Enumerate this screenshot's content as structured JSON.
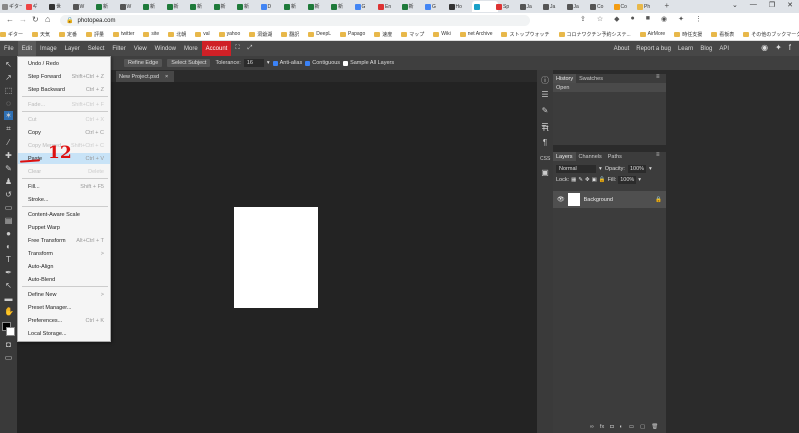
{
  "browser": {
    "tabs": [
      {
        "label": "ギター",
        "color": "#888"
      },
      {
        "label": "ギ",
        "color": "#e44"
      },
      {
        "label": "世",
        "color": "#333"
      },
      {
        "label": "W",
        "color": "#555"
      },
      {
        "label": "新",
        "color": "#1e7a3a"
      },
      {
        "label": "W",
        "color": "#555"
      },
      {
        "label": "新",
        "color": "#1e7a3a"
      },
      {
        "label": "新",
        "color": "#1e7a3a"
      },
      {
        "label": "新",
        "color": "#1e7a3a"
      },
      {
        "label": "新",
        "color": "#1e7a3a"
      },
      {
        "label": "新",
        "color": "#1e7a3a"
      },
      {
        "label": "D",
        "color": "#4285f4"
      },
      {
        "label": "新",
        "color": "#1e7a3a"
      },
      {
        "label": "新",
        "color": "#1e7a3a"
      },
      {
        "label": "新",
        "color": "#1e7a3a"
      },
      {
        "label": "G",
        "color": "#4285f4"
      },
      {
        "label": "En",
        "color": "#d33"
      },
      {
        "label": "新",
        "color": "#1e7a3a"
      },
      {
        "label": "G",
        "color": "#4285f4"
      },
      {
        "label": "Ho",
        "color": "#333"
      },
      {
        "label": "",
        "color": "#18a0c8"
      },
      {
        "label": "Sp",
        "color": "#d33"
      },
      {
        "label": "Ja",
        "color": "#555"
      },
      {
        "label": "Ja",
        "color": "#555"
      },
      {
        "label": "Ja",
        "color": "#555"
      },
      {
        "label": "Co",
        "color": "#555"
      },
      {
        "label": "Co",
        "color": "#f39c12"
      },
      {
        "label": "Ph",
        "color": "#e8b84a"
      }
    ],
    "url": "photopea.com",
    "bookmarks": [
      "ギター",
      "天気",
      "定番",
      "評量",
      "twitter",
      "site",
      "北朝",
      "val",
      "yahoo",
      "洞爺湖",
      "翻訳",
      "DeepL",
      "Papago",
      "速度",
      "マップ",
      "Wiki",
      "net Archive",
      "ストップウォッチ",
      "コロナワクチン予約システ...",
      "AirMore",
      "時任支援",
      "看板表",
      "その他のブックマーク"
    ]
  },
  "menubar": {
    "items": [
      "File",
      "Edit",
      "Image",
      "Layer",
      "Select",
      "Filter",
      "View",
      "Window",
      "More",
      "Account"
    ],
    "right": [
      "About",
      "Report a bug",
      "Learn",
      "Blog",
      "API"
    ]
  },
  "options": {
    "refine_edge": "Refine Edge",
    "select_subject": "Select Subject",
    "tolerance_label": "Tolerance:",
    "tolerance_value": "16",
    "anti_alias": "Anti-alias",
    "contiguous": "Contiguous",
    "sample_all": "Sample All Layers"
  },
  "document": {
    "tab_name": "New Project.psd",
    "close": "×"
  },
  "edit_menu": [
    {
      "label": "Undo / Redo",
      "shortcut": "",
      "disabled": false,
      "sep_after": false
    },
    {
      "label": "Step Forward",
      "shortcut": "Shift+Ctrl + Z",
      "disabled": false,
      "sep_after": false
    },
    {
      "label": "Step Backward",
      "shortcut": "Ctrl + Z",
      "disabled": false,
      "sep_after": true
    },
    {
      "label": "Fade...",
      "shortcut": "Shift+Ctrl + F",
      "disabled": true,
      "sep_after": true
    },
    {
      "label": "Cut",
      "shortcut": "Ctrl + X",
      "disabled": true,
      "sep_after": false
    },
    {
      "label": "Copy",
      "shortcut": "Ctrl + C",
      "disabled": false,
      "sep_after": false
    },
    {
      "label": "Copy Merged",
      "shortcut": "Shift+Ctrl + C",
      "disabled": true,
      "sep_after": false
    },
    {
      "label": "Paste",
      "shortcut": "Ctrl + V",
      "disabled": false,
      "sep_after": false,
      "highlight": true
    },
    {
      "label": "Clear",
      "shortcut": "Delete",
      "disabled": true,
      "sep_after": true
    },
    {
      "label": "Fill...",
      "shortcut": "Shift + F5",
      "disabled": false,
      "sep_after": false
    },
    {
      "label": "Stroke...",
      "shortcut": "",
      "disabled": false,
      "sep_after": true
    },
    {
      "label": "Content-Aware Scale",
      "shortcut": "",
      "disabled": false,
      "sep_after": false
    },
    {
      "label": "Puppet Warp",
      "shortcut": "",
      "disabled": false,
      "sep_after": false
    },
    {
      "label": "Free Transform",
      "shortcut": "Alt+Ctrl + T",
      "disabled": false,
      "sep_after": false
    },
    {
      "label": "Transform",
      "shortcut": ">",
      "disabled": false,
      "sep_after": false
    },
    {
      "label": "Auto-Align",
      "shortcut": "",
      "disabled": false,
      "sep_after": false
    },
    {
      "label": "Auto-Blend",
      "shortcut": "",
      "disabled": false,
      "sep_after": true
    },
    {
      "label": "Define New",
      "shortcut": ">",
      "disabled": false,
      "sep_after": false
    },
    {
      "label": "Preset Manager...",
      "shortcut": "",
      "disabled": false,
      "sep_after": false
    },
    {
      "label": "Preferences...",
      "shortcut": "Ctrl + K",
      "disabled": false,
      "sep_after": false
    },
    {
      "label": "Local Storage...",
      "shortcut": "",
      "disabled": false,
      "sep_after": false
    }
  ],
  "annotation": {
    "number": "12"
  },
  "history": {
    "tabs": [
      "History",
      "Swatches"
    ],
    "items": [
      "Open"
    ]
  },
  "layers": {
    "tabs": [
      "Layers",
      "Channels",
      "Paths"
    ],
    "blend_mode": "Normal",
    "opacity_label": "Opacity:",
    "opacity": "100%",
    "lock_label": "Lock:",
    "fill_label": "Fill:",
    "fill": "100%",
    "layer_name": "Background"
  },
  "panel_icons": {
    "css": "CSS"
  },
  "colors": {
    "account": "#cf2026",
    "highlight": "#c8e3f7",
    "annotation": "#dd1111"
  }
}
